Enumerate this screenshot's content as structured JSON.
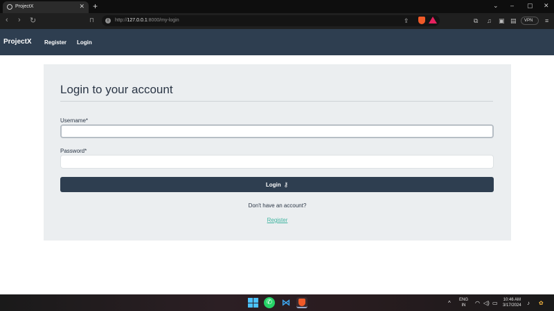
{
  "browser": {
    "tab_title": "ProjectX",
    "tab_close": "✕",
    "new_tab": "+",
    "window_controls": [
      "⌄",
      "–",
      "▢",
      "✕"
    ],
    "nav": {
      "back": "‹",
      "forward": "›",
      "reload": "↻",
      "bookmark": "⊓"
    },
    "url_prefix": "http://",
    "url_host": "127.0.0.1",
    "url_rest": ":8000/my-login",
    "vpn_label": "VPN",
    "menu": "≡"
  },
  "site": {
    "brand": "ProjectX",
    "nav_links": [
      "Register",
      "Login"
    ]
  },
  "login": {
    "heading": "Login to your account",
    "username_label": "Username*",
    "username_value": "",
    "password_label": "Password*",
    "password_value": "",
    "button_label": "Login",
    "prompt": "Don't have an account?",
    "register_link": "Register"
  },
  "taskbar": {
    "lang": "ENG",
    "region": "IN",
    "time": "10:46 AM",
    "date": "3/17/2024"
  },
  "colors": {
    "navbar": "#2e3e50",
    "card": "#ebeef0",
    "link": "#3fb4a0"
  }
}
